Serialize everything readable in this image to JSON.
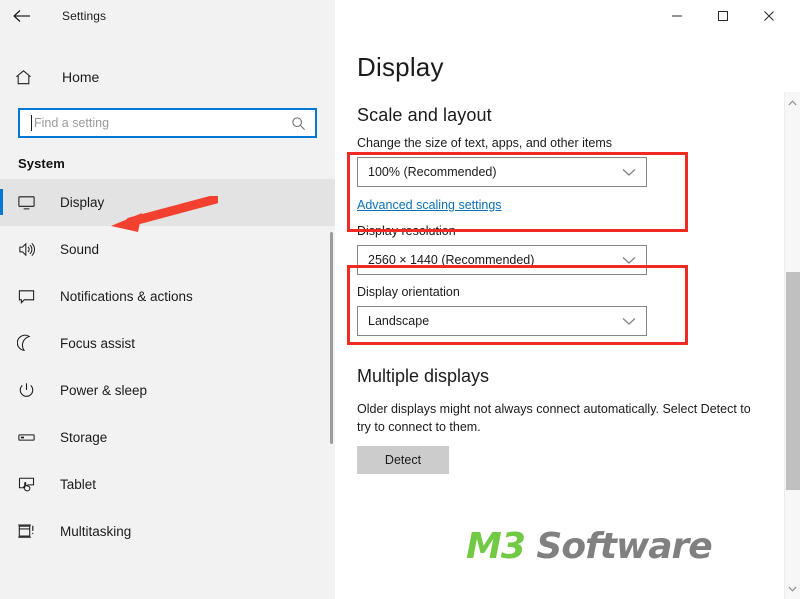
{
  "window": {
    "title": "Settings",
    "back_icon": "back-arrow-icon",
    "controls": {
      "minimize": "minimize-icon",
      "maximize": "maximize-icon",
      "close": "close-icon"
    }
  },
  "sidebar": {
    "home_label": "Home",
    "home_icon": "home-icon",
    "search": {
      "placeholder": "Find a setting",
      "icon": "search-icon"
    },
    "section_title": "System",
    "items": [
      {
        "label": "Display",
        "icon": "monitor-icon",
        "selected": true
      },
      {
        "label": "Sound",
        "icon": "speaker-icon",
        "selected": false
      },
      {
        "label": "Notifications & actions",
        "icon": "notification-icon",
        "selected": false
      },
      {
        "label": "Focus assist",
        "icon": "moon-icon",
        "selected": false
      },
      {
        "label": "Power & sleep",
        "icon": "power-icon",
        "selected": false
      },
      {
        "label": "Storage",
        "icon": "drive-icon",
        "selected": false
      },
      {
        "label": "Tablet",
        "icon": "tablet-icon",
        "selected": false
      },
      {
        "label": "Multitasking",
        "icon": "multitasking-icon",
        "selected": false
      }
    ]
  },
  "main": {
    "page_title": "Display",
    "scale_section": {
      "heading": "Scale and layout",
      "scale_label": "Change the size of text, apps, and other items",
      "scale_value": "100% (Recommended)",
      "advanced_link": "Advanced scaling settings",
      "resolution_label": "Display resolution",
      "resolution_value": "2560 × 1440 (Recommended)",
      "orientation_label": "Display orientation",
      "orientation_value": "Landscape"
    },
    "multiple_displays": {
      "heading": "Multiple displays",
      "description": "Older displays might not always connect automatically. Select Detect to try to connect to them.",
      "detect_button": "Detect"
    }
  },
  "annotations": {
    "highlight_color": "#ef2b24",
    "arrow_target": "Display",
    "boxes": [
      "scale-setting",
      "display-resolution-setting"
    ]
  },
  "watermark": {
    "part1": "M3",
    "part2": " Software",
    "color1": "#72c944",
    "color2": "#808080"
  },
  "theme": {
    "accent": "#0078d4",
    "sidebar_bg": "#f2f2f2",
    "link": "#0b6fb5"
  }
}
